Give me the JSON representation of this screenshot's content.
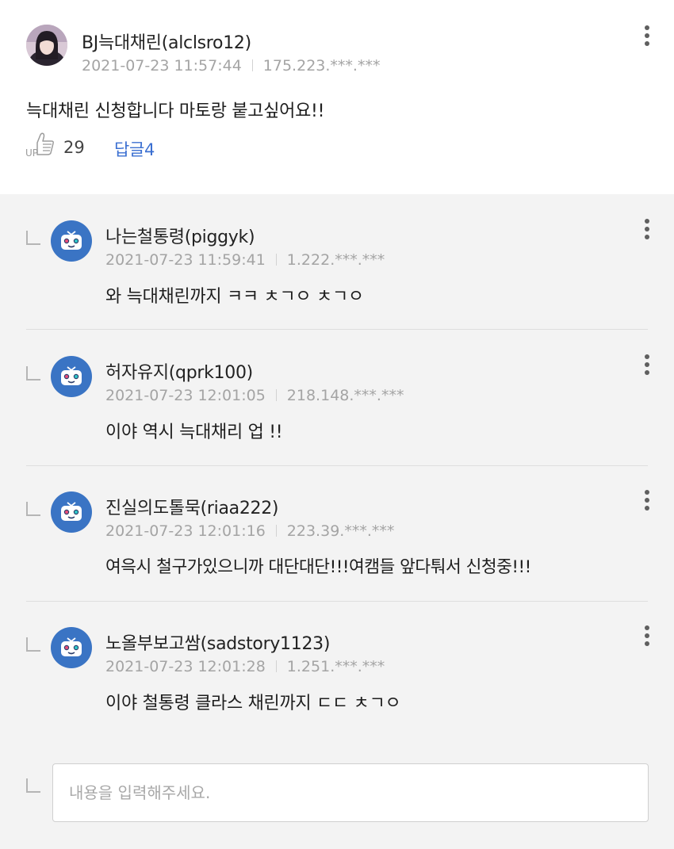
{
  "main_comment": {
    "author": "BJ늑대채린(alclsro12)",
    "datetime": "2021-07-23 11:57:44",
    "ip": "175.223.***.***",
    "text": "늑대채린 신청합니다 마토랑 붙고싶어요!!",
    "up_label": "UP",
    "up_count": "29",
    "reply_label": "답글4"
  },
  "replies": [
    {
      "author": "나는철통령(piggyk)",
      "datetime": "2021-07-23 11:59:41",
      "ip": "1.222.***.***",
      "text": "와 늑대채린까지 ㅋㅋ ㅊㄱㅇ ㅊㄱㅇ"
    },
    {
      "author": "허자유지(qprk100)",
      "datetime": "2021-07-23 12:01:05",
      "ip": "218.148.***.***",
      "text": "이야 역시 늑대채리 업 !!"
    },
    {
      "author": "진실의도톨묵(riaa222)",
      "datetime": "2021-07-23 12:01:16",
      "ip": "223.39.***.***",
      "text": "여윽시 철구가있으니까 대단대단!!!여캠들 앞다퉈서 신청중!!!"
    },
    {
      "author": "노올부보고쌈(sadstory1123)",
      "datetime": "2021-07-23 12:01:28",
      "ip": "1.251.***.***",
      "text": "이야 철통령 클라스 채린까지 ㄷㄷ ㅊㄱㅇ"
    }
  ],
  "reply_input": {
    "placeholder": "내용을 입력해주세요.",
    "value": ""
  },
  "colors": {
    "accent_link": "#3b6fd1",
    "reply_bg": "#f3f3f3",
    "bot_avatar": "#3a74c4"
  },
  "icons": {
    "up": "thumbs-up-icon",
    "more": "more-vertical-icon",
    "reply": "reply-arrow-icon",
    "bot_avatar": "tv-mascot-icon"
  }
}
